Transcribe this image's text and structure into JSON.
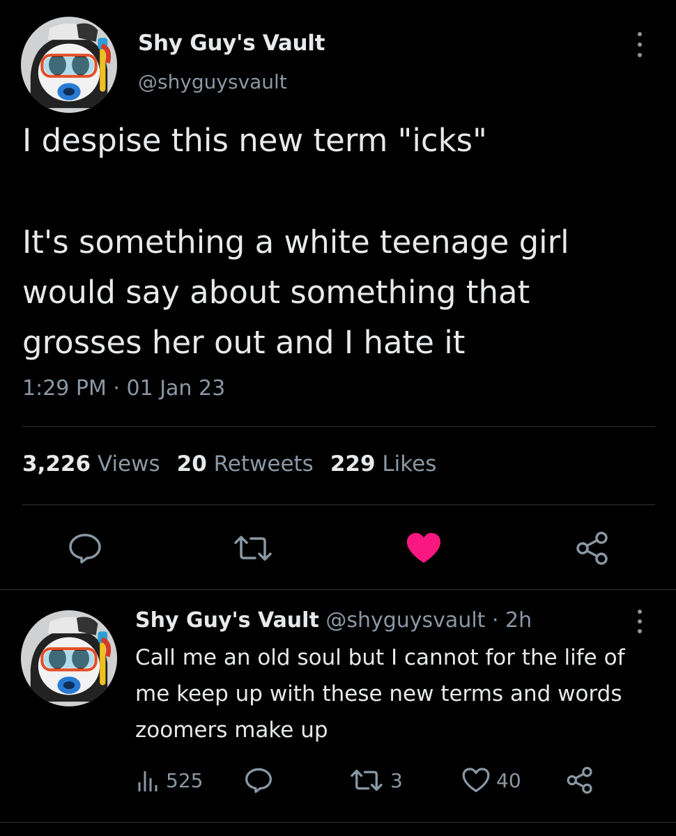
{
  "main_tweet": {
    "display_name": "Shy Guy's Vault",
    "handle": "@shyguysvault",
    "text_line1": "I despise this new term \"icks\"",
    "text_line2": "It's something a white teenage girl would say about something that grosses her out and I hate it",
    "timestamp": "1:29 PM · 01 Jan 23",
    "stats": {
      "views_count": "3,226",
      "views_label": "Views",
      "retweets_count": "20",
      "retweets_label": "Retweets",
      "likes_count": "229",
      "likes_label": "Likes"
    },
    "liked": true,
    "like_color": "#f91880"
  },
  "reply": {
    "display_name": "Shy Guy's Vault",
    "handle": "@shyguysvault",
    "separator": " · ",
    "time": "2h",
    "text": "Call me an old soul but I cannot for the life of me keep up with these new terms and words zoomers make up",
    "views": "525",
    "retweets": "3",
    "likes": "40"
  },
  "icons": [
    "more-icon",
    "reply-icon",
    "retweet-icon",
    "heart-icon",
    "share-icon",
    "views-icon"
  ],
  "colors": {
    "background": "#000000",
    "text_primary": "#e7e9ea",
    "text_secondary": "#8b98a5",
    "divider": "#2f3336"
  }
}
